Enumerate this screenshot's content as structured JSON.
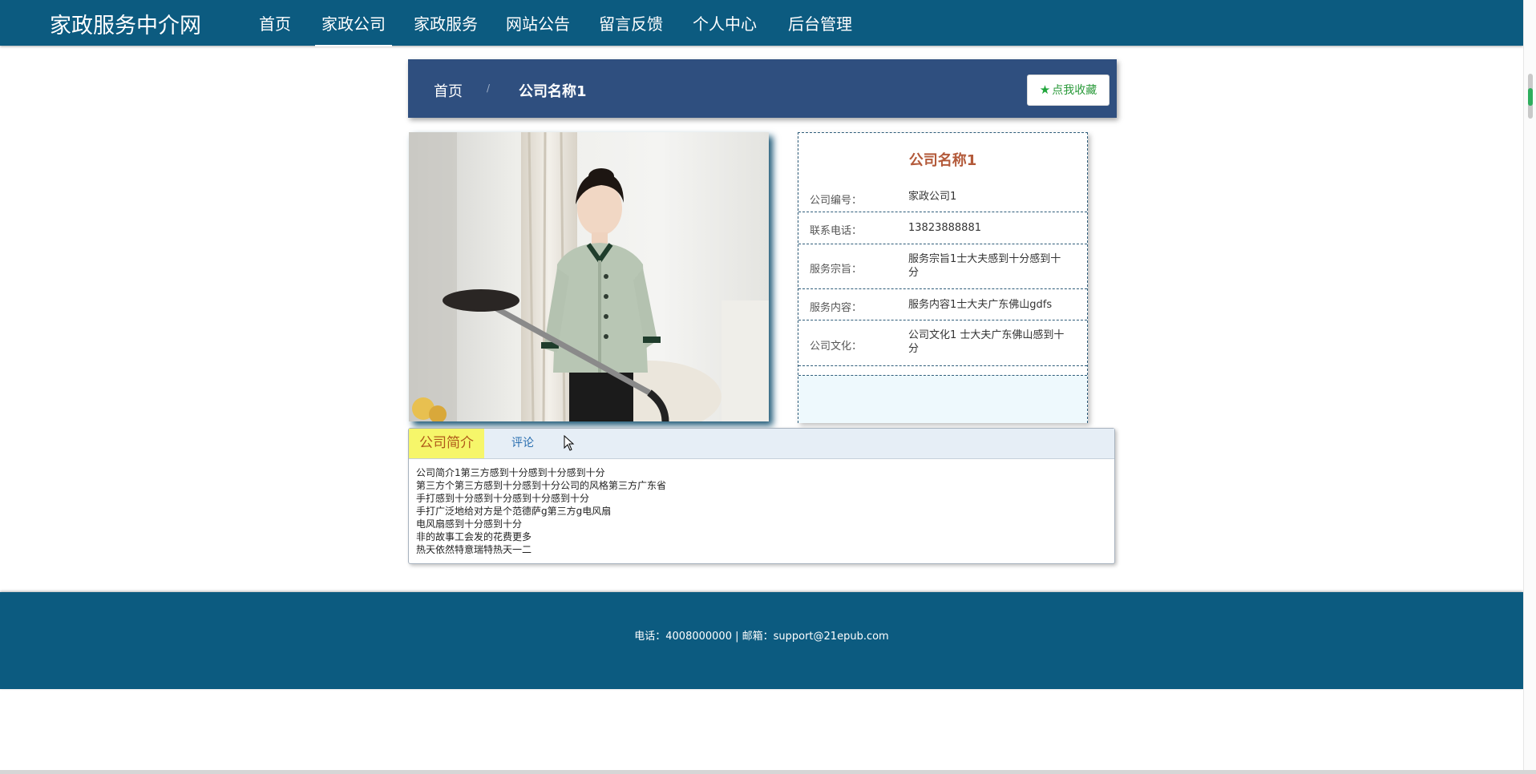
{
  "brand": "家政服务中介网",
  "nav": [
    {
      "label": "首页",
      "active": false
    },
    {
      "label": "家政公司",
      "active": true
    },
    {
      "label": "家政服务",
      "active": false
    },
    {
      "label": "网站公告",
      "active": false
    },
    {
      "label": "留言反馈",
      "active": false
    },
    {
      "label": "个人中心",
      "active": false
    },
    {
      "label": "后台管理",
      "active": false
    }
  ],
  "breadcrumb": {
    "home": "首页",
    "separator": "/",
    "current": "公司名称1"
  },
  "favorite_button": "点我收藏",
  "company": {
    "name": "公司名称1",
    "fields": [
      {
        "label": "公司编号：",
        "value": "家政公司1"
      },
      {
        "label": "联系电话：",
        "value": "13823888881"
      },
      {
        "label": "服务宗旨：",
        "value": "服务宗旨1士大夫感到十分感到十分"
      },
      {
        "label": "服务内容：",
        "value": "服务内容1士大夫广东佛山gdfs"
      },
      {
        "label": "公司文化：",
        "value": "公司文化1 士大夫广东佛山感到十分"
      }
    ]
  },
  "tabs": [
    {
      "label": "公司简介",
      "active": true
    },
    {
      "label": "评论",
      "active": false
    }
  ],
  "intro_lines": [
    "公司简介1第三方感到十分感到十分感到十分",
    "第三方个第三方感到十分感到十分公司的风格第三方广东省",
    "手打感到十分感到十分感到十分感到十分",
    "手打广泛地给对方是个范德萨g第三方g电风扇",
    "电风扇感到十分感到十分",
    "非的故事工会发的花费更多",
    "热天依然特意瑞特热天一二"
  ],
  "footer": "电话：4008000000 | 邮箱：support@21epub.com",
  "colors": {
    "header_bg": "#0c5b80",
    "breadcrumb_bg": "#2f4f7f",
    "title_color": "#b35a3a",
    "tab_active_bg": "#f6f66a",
    "favorite_color": "#1fa53a"
  }
}
